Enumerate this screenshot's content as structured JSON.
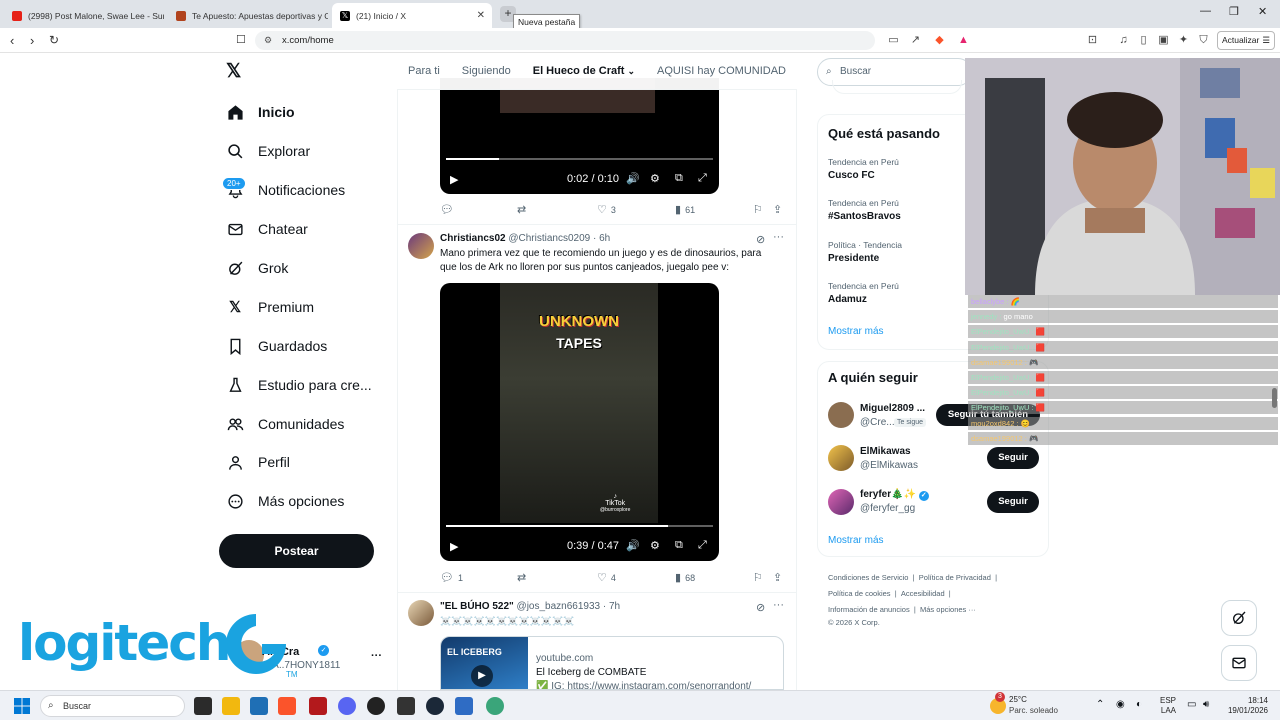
{
  "browser": {
    "tabs": [
      {
        "title": "(2998) Post Malone, Swae Lee - Sunfl",
        "color": "#e62117"
      },
      {
        "title": "Te Apuesto: Apuestas deportivas y C",
        "color": "#b1431d"
      },
      {
        "title": "(21) Inicio / X",
        "color": "#000000"
      }
    ],
    "tooltip": "Nueva pestaña",
    "url": "x.com/home",
    "update_label": "Actualizar"
  },
  "nav": {
    "items": [
      {
        "label": "Inicio"
      },
      {
        "label": "Explorar"
      },
      {
        "label": "Notificaciones"
      },
      {
        "label": "Chatear"
      },
      {
        "label": "Grok"
      },
      {
        "label": "Premium"
      },
      {
        "label": "Guardados"
      },
      {
        "label": "Estudio para cre..."
      },
      {
        "label": "Comunidades"
      },
      {
        "label": "Perfil"
      },
      {
        "label": "Más opciones"
      }
    ],
    "notif_badge": "20+",
    "post_button": "Postear",
    "account_name": "ANICra",
    "account_handle": "@A..7HONY1811"
  },
  "feed": {
    "tabs": [
      "Para ti",
      "Siguiendo",
      "El Hueco de Craft",
      "AQUISI hay COMUNIDAD"
    ],
    "post1": {
      "time": "0:02 / 0:10",
      "progress": 0.2,
      "likes": "3",
      "views": "61"
    },
    "post2": {
      "name": "Christiancs02",
      "handle": "@Christiancs0209",
      "age": "· 6h",
      "text": "Mano primera vez que te recomiendo un juego y es de dinosaurios, para que los de Ark no lloren por sus puntos canjeados, juegalo pee v:",
      "video_title1": "UNKNOWN",
      "video_title2": "TAPES",
      "tiktok": "TikTok",
      "tiktok_handle": "@burroxplore",
      "time": "0:39 / 0:47",
      "progress": 0.83,
      "replies": "1",
      "likes": "4",
      "views": "68"
    },
    "post3": {
      "name": "\"EL BÚHO 522\"",
      "handle": "@jos_bazn661933",
      "age": "· 7h",
      "text": "☠️☠️☠️☠️☠️☠️☠️☠️☠️☠️☠️☠️",
      "card_domain": "youtube.com",
      "card_title": "El Iceberg de COMBATE",
      "card_desc": "✅ IG: https://www.instagram.com/senorrandont/"
    }
  },
  "right": {
    "search_placeholder": "Buscar",
    "trends_title": "Qué está pasando",
    "trends": [
      {
        "meta": "Tendencia en Perú",
        "name": "Cusco FC"
      },
      {
        "meta": "Tendencia en Perú",
        "name": "#SantosBravos"
      },
      {
        "meta": "Política · Tendencia",
        "name": "Presidente"
      },
      {
        "meta": "Tendencia en Perú",
        "name": "Adamuz"
      }
    ],
    "show_more": "Mostrar más",
    "follow_title": "A quién seguir",
    "follows": [
      {
        "name": "Miguel2809 ...",
        "handle": "@Cre...",
        "tag": "Te sigue",
        "button": "Seguir tú también"
      },
      {
        "name": "ElMikawas",
        "handle": "@ElMikawas",
        "button": "Seguir"
      },
      {
        "name": "feryfer🎄✨",
        "handle": "@feryfer_gg",
        "button": "Seguir"
      }
    ],
    "follow_more": "Mostrar más",
    "footer": [
      [
        "Condiciones de Servicio",
        "|",
        "Política de Privacidad",
        "|"
      ],
      [
        "Política de cookies",
        "|",
        "Accesibilidad",
        "|"
      ],
      [
        "Información de anuncios",
        "|",
        "Más opciones ···"
      ],
      [
        "© 2026 X Corp."
      ]
    ]
  },
  "chat": [
    {
      "user": "bellaclybe :",
      "msg": "🌈"
    },
    {
      "user": "jennedy :",
      "msg": "go mano"
    },
    {
      "user": "ElPendejito_UwU :",
      "msg": "🟥"
    },
    {
      "user": "ElPendejito_UwU :",
      "msg": "🟥"
    },
    {
      "user": "dsamae199012 :",
      "msg": "🎮"
    },
    {
      "user": "ElPendejito_UwU :",
      "msg": "🟥"
    },
    {
      "user": "ElPendejito_UwU :",
      "msg": "🟥"
    },
    {
      "user": "ElPendejito_UwU :",
      "msg": "🟥"
    },
    {
      "user": "mou2oxd842 :",
      "msg": "😊"
    },
    {
      "user": "dsamae199012 :",
      "msg": "🎮"
    }
  ],
  "watermark": {
    "brand": "logitech",
    "tm": "TM"
  },
  "taskbar": {
    "search": "Buscar",
    "weather_temp": "25°C",
    "weather_desc": "Parc. soleado",
    "weather_badge": "3",
    "lang1": "ESP",
    "lang2": "LAA",
    "time": "18:14",
    "date": "19/01/2026"
  }
}
